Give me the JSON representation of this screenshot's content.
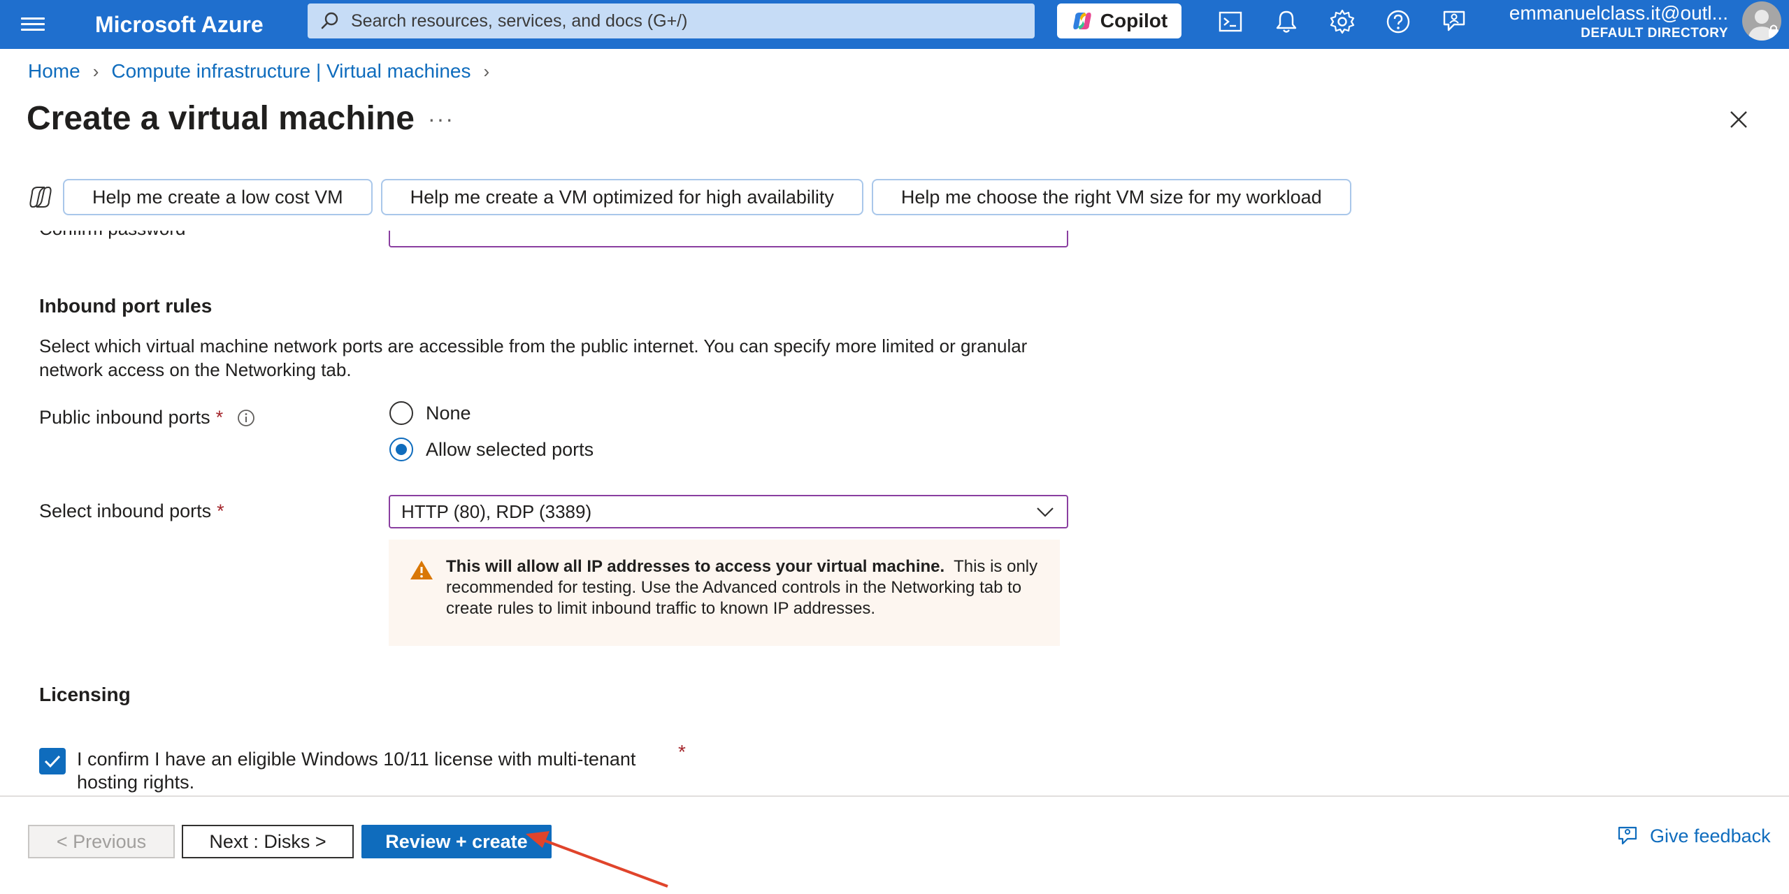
{
  "topbar": {
    "brand": "Microsoft Azure",
    "search_placeholder": "Search resources, services, and docs (G+/)",
    "copilot_label": "Copilot",
    "account_email": "emmanuelclass.it@outl...",
    "account_directory": "DEFAULT DIRECTORY",
    "icons": [
      "menu-icon",
      "search-icon",
      "cloud-shell-icon",
      "notifications-icon",
      "settings-icon",
      "help-icon",
      "feedback-icon"
    ]
  },
  "breadcrumb": {
    "items": [
      "Home",
      "Compute infrastructure | Virtual machines"
    ]
  },
  "page": {
    "title": "Create a virtual machine",
    "more": "···"
  },
  "copilot_prompts": [
    "Help me create a low cost VM",
    "Help me create a VM optimized for high availability",
    "Help me choose the right VM size for my workload"
  ],
  "form": {
    "confirm_password_label": "Confirm password",
    "inbound": {
      "heading": "Inbound port rules",
      "description": "Select which virtual machine network ports are accessible from the public internet. You can specify more limited or granular network access on the Networking tab.",
      "public_ports_label": "Public inbound ports",
      "options": [
        "None",
        "Allow selected ports"
      ],
      "selected_option": "Allow selected ports",
      "select_ports_label": "Select inbound ports",
      "select_ports_value": "HTTP (80), RDP (3389)",
      "required_mark": "*",
      "warning_bold": "This will allow all IP addresses to access your virtual machine.",
      "warning_text": "This is only recommended for testing.  Use the Advanced controls in the Networking tab to create rules to limit inbound traffic to known IP addresses."
    },
    "licensing": {
      "heading": "Licensing",
      "confirm_label": "I confirm I have an eligible Windows 10/11 license with multi-tenant hosting rights.",
      "checked": true,
      "required_mark": "*"
    }
  },
  "footer": {
    "previous_label": "< Previous",
    "next_label": "Next : Disks >",
    "review_label": "Review + create",
    "feedback_label": "Give feedback"
  },
  "colors": {
    "topbar": "#1f6fce",
    "accent": "#0f6cbd",
    "warning_bg": "#fdf6f0",
    "warning_icon": "#d97706",
    "annotation_arrow": "#e0442b"
  }
}
